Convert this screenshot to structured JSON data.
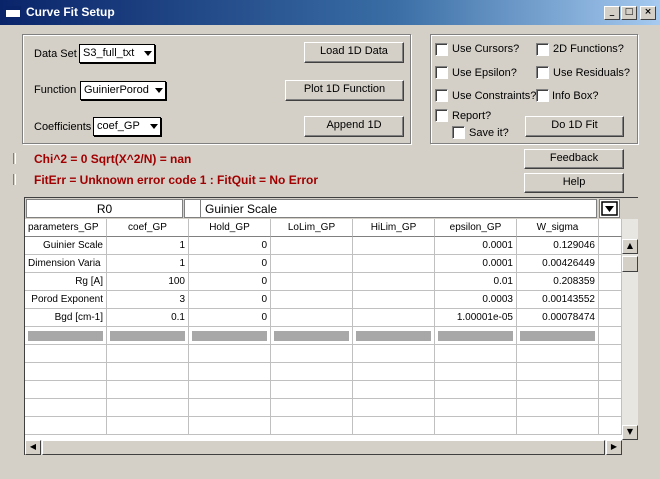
{
  "window": {
    "title": "Curve Fit Setup",
    "minimize_label": "_",
    "maximize_label": "□",
    "close_label": "×"
  },
  "setup": {
    "dataset_label": "Data Set",
    "dataset_value": "S3_full_txt",
    "function_label": "Function",
    "function_value": "GuinierPorod",
    "coefficients_label": "Coefficients",
    "coefficients_value": "coef_GP",
    "load_button": "Load 1D Data",
    "plot_button": "Plot 1D Function",
    "append_button": "Append 1D"
  },
  "options": {
    "use_cursors": "Use Cursors?",
    "functions_2d": "2D Functions?",
    "use_epsilon": "Use Epsilon?",
    "use_residuals": "Use Residuals?",
    "use_constraints": "Use Constraints?",
    "info_box": "Info Box?",
    "report": "Report?",
    "save_it": "Save it?",
    "do_fit_button": "Do 1D Fit"
  },
  "status": {
    "chi_line": "Chi^2 = 0  Sqrt(X^2/N) = nan",
    "fiterr_line": "FitErr = Unknown error code 1 : FitQuit = No Error"
  },
  "side_buttons": {
    "feedback": "Feedback",
    "help": "Help"
  },
  "table": {
    "entry_row_label": "R0",
    "entry_value": "Guinier Scale",
    "columns": [
      "parameters_GP",
      "coef_GP",
      "Hold_GP",
      "LoLim_GP",
      "HiLim_GP",
      "epsilon_GP",
      "W_sigma"
    ],
    "rows": [
      {
        "param": "Guinier Scale",
        "coef": "1",
        "hold": "0",
        "lolim": "",
        "hilim": "",
        "epsilon": "0.0001",
        "sigma": "0.129046"
      },
      {
        "param": "Dimension Varia",
        "coef": "1",
        "hold": "0",
        "lolim": "",
        "hilim": "",
        "epsilon": "0.0001",
        "sigma": "0.00426449"
      },
      {
        "param": "Rg [A]",
        "coef": "100",
        "hold": "0",
        "lolim": "",
        "hilim": "",
        "epsilon": "0.01",
        "sigma": "0.208359"
      },
      {
        "param": "Porod Exponent",
        "coef": "3",
        "hold": "0",
        "lolim": "",
        "hilim": "",
        "epsilon": "0.0003",
        "sigma": "0.00143552"
      },
      {
        "param": "Bgd [cm-1]",
        "coef": "0.1",
        "hold": "0",
        "lolim": "",
        "hilim": "",
        "epsilon": "1.00001e-05",
        "sigma": "0.00078474"
      }
    ]
  }
}
